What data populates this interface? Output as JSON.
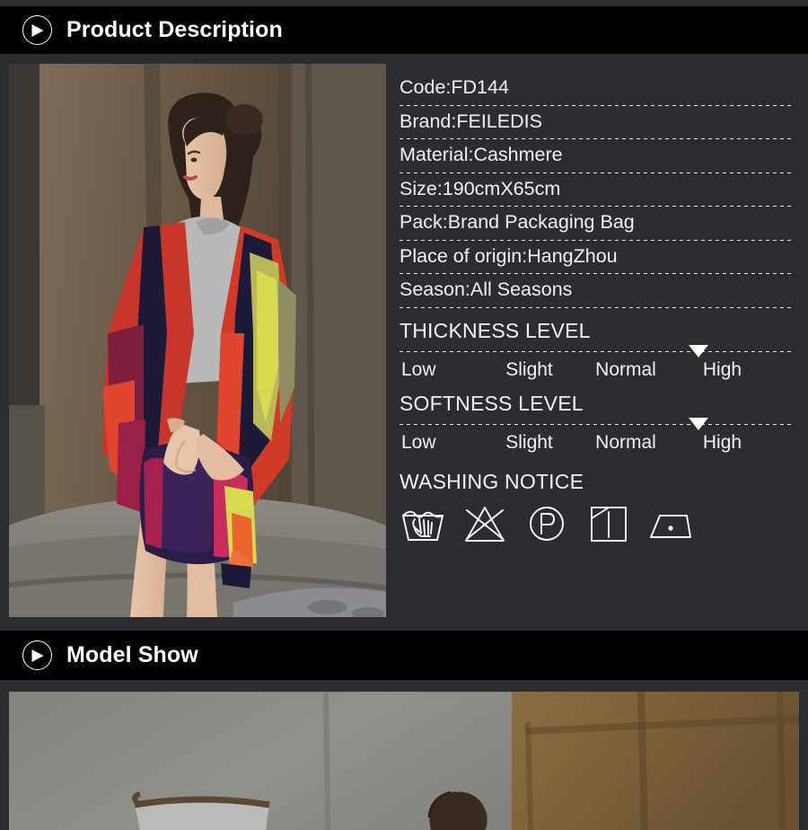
{
  "sections": {
    "description": {
      "title": "Product Description",
      "icon": "play-arrow-circle-icon"
    },
    "model": {
      "title": "Model Show",
      "icon": "play-arrow-circle-icon"
    }
  },
  "specs": [
    {
      "label": "Code",
      "value": "FD144",
      "text": "Code:FD144"
    },
    {
      "label": "Brand",
      "value": "FEILEDIS",
      "text": "Brand:FEILEDIS"
    },
    {
      "label": "Material",
      "value": "Cashmere",
      "text": "Material:Cashmere"
    },
    {
      "label": "Size",
      "value": "190cmX65cm",
      "text": "Size:190cmX65cm"
    },
    {
      "label": "Pack",
      "value": "Brand Packaging Bag",
      "text": "Pack:Brand Packaging Bag"
    },
    {
      "label": "Place of origin",
      "value": "HangZhou",
      "text": "Place of origin:HangZhou"
    },
    {
      "label": "Season",
      "value": "All Seasons",
      "text": "Season:All Seasons"
    }
  ],
  "levels": [
    {
      "title": "THICKNESS LEVEL",
      "options": [
        "Low",
        "Slight",
        "Normal",
        "High"
      ],
      "selected": "High",
      "selected_index": 3
    },
    {
      "title": "SOFTNESS LEVEL",
      "options": [
        "Low",
        "Slight",
        "Normal",
        "High"
      ],
      "selected": "High",
      "selected_index": 3
    }
  ],
  "washing": {
    "title": "WASHING NOTICE",
    "icons": [
      {
        "name": "hand-wash-icon",
        "meaning": "Hand wash"
      },
      {
        "name": "do-not-bleach-icon",
        "meaning": "Do not bleach"
      },
      {
        "name": "dry-clean-p-icon",
        "meaning": "Dry clean, any solvent except trichloroethylene"
      },
      {
        "name": "drip-dry-icon",
        "meaning": "Drip dry / line dry in shade"
      },
      {
        "name": "iron-low-heat-icon",
        "meaning": "Iron low heat (one dot)"
      }
    ]
  },
  "photos": {
    "product": {
      "name": "product-photo",
      "alt": "Model wearing multicolor geometric cashmere scarf over grey sweater"
    },
    "model": {
      "name": "model-photo",
      "alt": "Model show photo, interior room with wooden wall"
    }
  },
  "colors": {
    "page_background": "#2b2d31",
    "header_bar": "#000000",
    "text": "#f2f2f2",
    "divider": "#e8e8e8"
  }
}
